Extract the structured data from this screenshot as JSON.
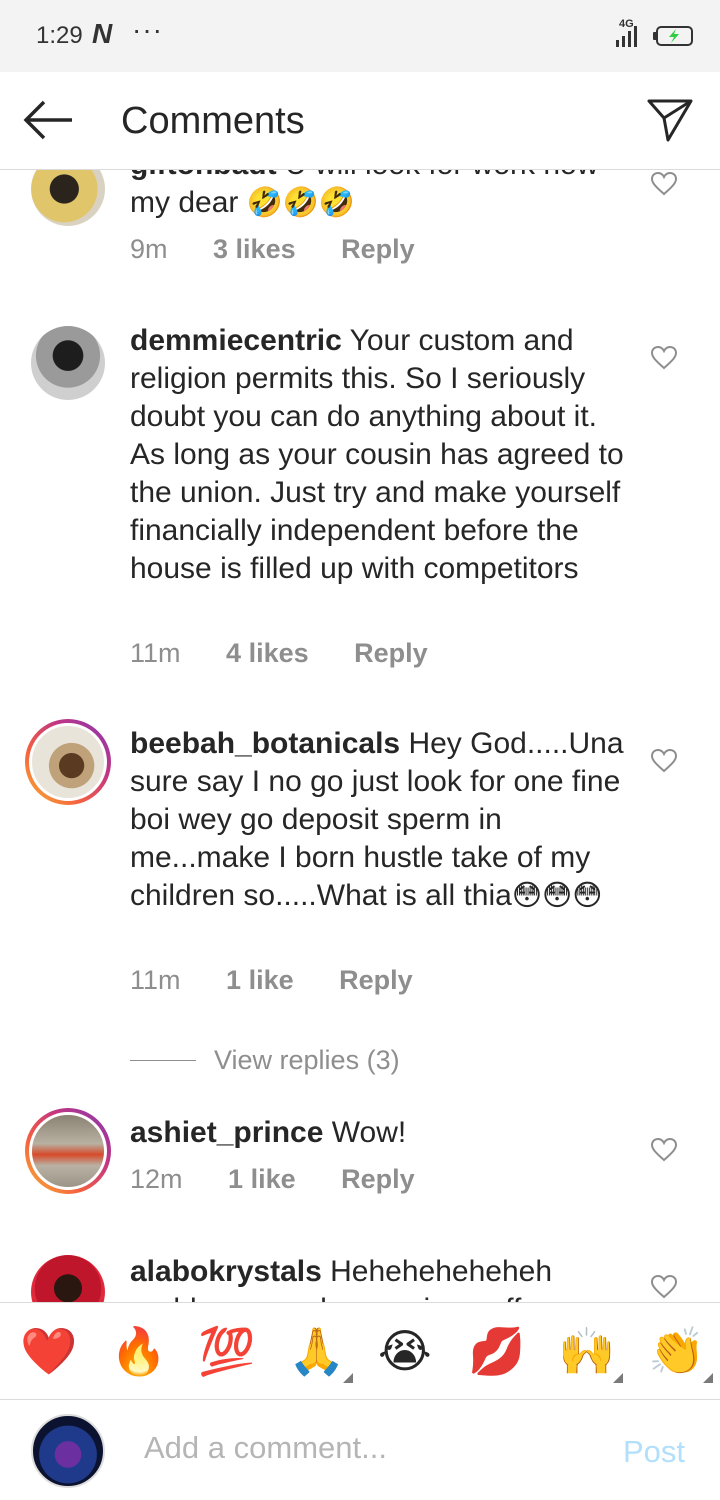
{
  "status_bar": {
    "time": "1:29",
    "notif_icon": "N",
    "more": "···",
    "network": "4G"
  },
  "header": {
    "title": "Comments",
    "back_icon": "arrow-left-icon",
    "share_icon": "direct-message-icon"
  },
  "comments": [
    {
      "username": "giftonbadt",
      "text": "U will look for work now my dear",
      "emojis": "🤣🤣🤣",
      "time": "9m",
      "likes": "3 likes",
      "reply": "Reply"
    },
    {
      "username": "demmiecentric",
      "text": "Your custom and religion permits this. So I seriously doubt you can do anything about it. As long as your cousin has agreed to the union. Just try and make yourself financially independent before the house is filled up with competitors",
      "time": "11m",
      "likes": "4 likes",
      "reply": "Reply"
    },
    {
      "username": "beebah_botanicals",
      "text": "Hey God.....Una sure say I no go just look for one fine boi wey go deposit sperm in me...make I born hustle take of my children so.....What is all thia",
      "emojis": "😳😳😳",
      "time": "11m",
      "likes": "1 like",
      "reply": "Reply",
      "view_replies": "View replies (3)"
    },
    {
      "username": "ashiet_prince",
      "text": "Wow!",
      "time": "12m",
      "likes": "1 like",
      "reply": "Reply"
    },
    {
      "username": "alabokrystals",
      "text": "Heheheheheheh problem na yeh.. marriage off"
    }
  ],
  "quick_emojis": [
    "❤️",
    "🔥",
    "💯",
    "🙏",
    "😭",
    "💋",
    "🙌",
    "👏"
  ],
  "composer": {
    "placeholder": "Add a comment...",
    "post_label": "Post"
  },
  "colors": {
    "link_disabled": "#b2dffc",
    "secondary_text": "#8e8e8e",
    "primary_text": "#262626"
  }
}
